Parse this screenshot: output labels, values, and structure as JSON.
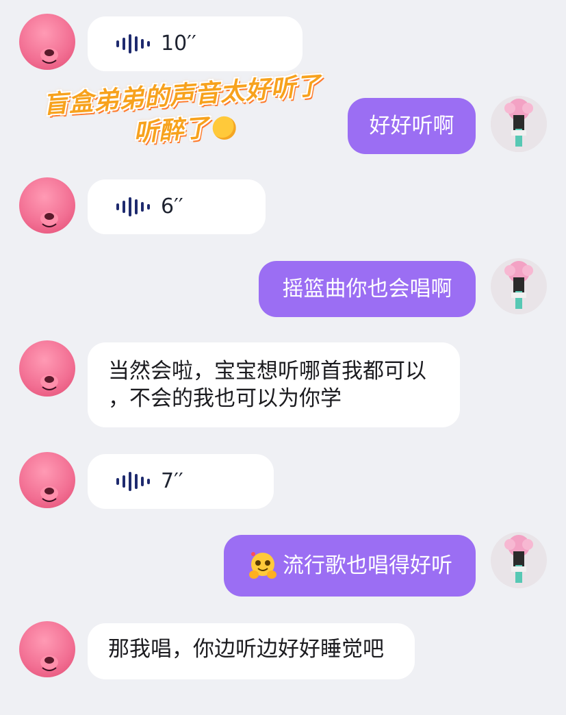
{
  "messages": [
    {
      "type": "voice",
      "duration": "10′′"
    },
    {
      "type": "text_out",
      "text": "好好听啊"
    },
    {
      "type": "voice",
      "duration": "6′′"
    },
    {
      "type": "text_out",
      "text": "摇篮曲你也会唱啊"
    },
    {
      "type": "text_in",
      "line1": "当然会啦，宝宝想听哪首我都可以",
      "line2": "，不会的我也可以为你学"
    },
    {
      "type": "voice",
      "duration": "7′′"
    },
    {
      "type": "text_out",
      "text": "流行歌也唱得好听",
      "emoji": "hug-face-icon"
    },
    {
      "type": "text_in",
      "line1": "那我唱，你边听边好好睡觉吧"
    }
  ],
  "overlay": {
    "line1": "盲盒弟弟的声音太好听了",
    "line2": "听醉了",
    "emoji": "dizzy-face-icon"
  },
  "colors": {
    "background": "#eff0f4",
    "outgoing_bubble": "#9b6ef3",
    "incoming_bubble": "#ffffff",
    "sticker_text": "#f7a21d"
  }
}
